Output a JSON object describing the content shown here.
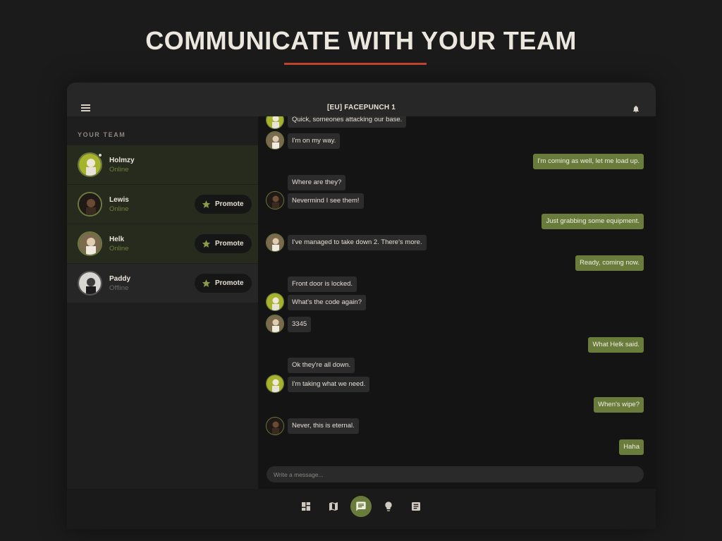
{
  "hero": {
    "title": "COMMUNICATE WITH YOUR TEAM"
  },
  "colors": {
    "accent": "#6a7c3c",
    "underline": "#c8462e"
  },
  "app": {
    "server_title": "[EU] FACEPUNCH 1",
    "team_heading": "YOUR TEAM",
    "promote_label": "Promote",
    "team": [
      {
        "name": "Holmzy",
        "status": "Online"
      },
      {
        "name": "Lewis",
        "status": "Online"
      },
      {
        "name": "Helk",
        "status": "Online"
      },
      {
        "name": "Paddy",
        "status": "Offline"
      }
    ],
    "messages": [
      {
        "dir": "in",
        "text": "Quick, someones attacking our base."
      },
      {
        "dir": "in",
        "text": "I'm on my way."
      },
      {
        "dir": "out",
        "text": "I'm coming as well, let me load up."
      },
      {
        "dir": "in",
        "text": "Where are they?"
      },
      {
        "dir": "in",
        "text": "Nevermind I see them!"
      },
      {
        "dir": "out",
        "text": "Just grabbing some equipment."
      },
      {
        "dir": "in",
        "text": "I've managed to take down 2. There's more."
      },
      {
        "dir": "out",
        "text": "Ready, coming now."
      },
      {
        "dir": "in",
        "text": "Front door is locked."
      },
      {
        "dir": "in",
        "text": "What's the code again?"
      },
      {
        "dir": "in",
        "text": "3345"
      },
      {
        "dir": "out",
        "text": "What Helk said."
      },
      {
        "dir": "in",
        "text": "Ok they're all down."
      },
      {
        "dir": "in",
        "text": "I'm taking what we need."
      },
      {
        "dir": "out",
        "text": "When's wipe?"
      },
      {
        "dir": "in",
        "text": "Never, this is eternal."
      },
      {
        "dir": "out",
        "text": "Haha"
      }
    ],
    "input_placeholder": "Write a message...",
    "nav": [
      "dashboard-icon",
      "map-icon",
      "chat-icon",
      "lightbulb-icon",
      "notes-icon"
    ]
  }
}
